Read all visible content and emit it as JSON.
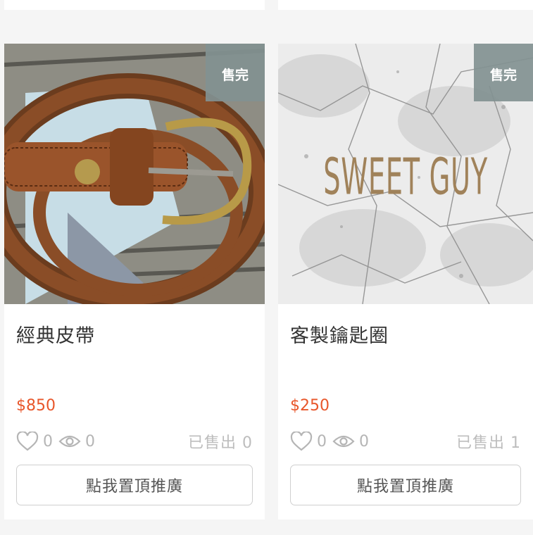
{
  "products": [
    {
      "title": "經典皮帶",
      "price": "$850",
      "badge": "售完",
      "likes": "0",
      "views": "0",
      "sold": "已售出 0",
      "button_label": "點我置頂推廣"
    },
    {
      "title": "客製鑰匙圈",
      "price": "$250",
      "badge": "售完",
      "image_text": "SWEET GUY",
      "likes": "0",
      "views": "0",
      "sold": "已售出 1",
      "button_label": "點我置頂推廣"
    }
  ],
  "icons": {
    "like": "heart-icon",
    "views": "eye-icon"
  },
  "colors": {
    "price": "#e8562a",
    "badge_bg": "#829191",
    "muted": "#b5b5b5"
  }
}
